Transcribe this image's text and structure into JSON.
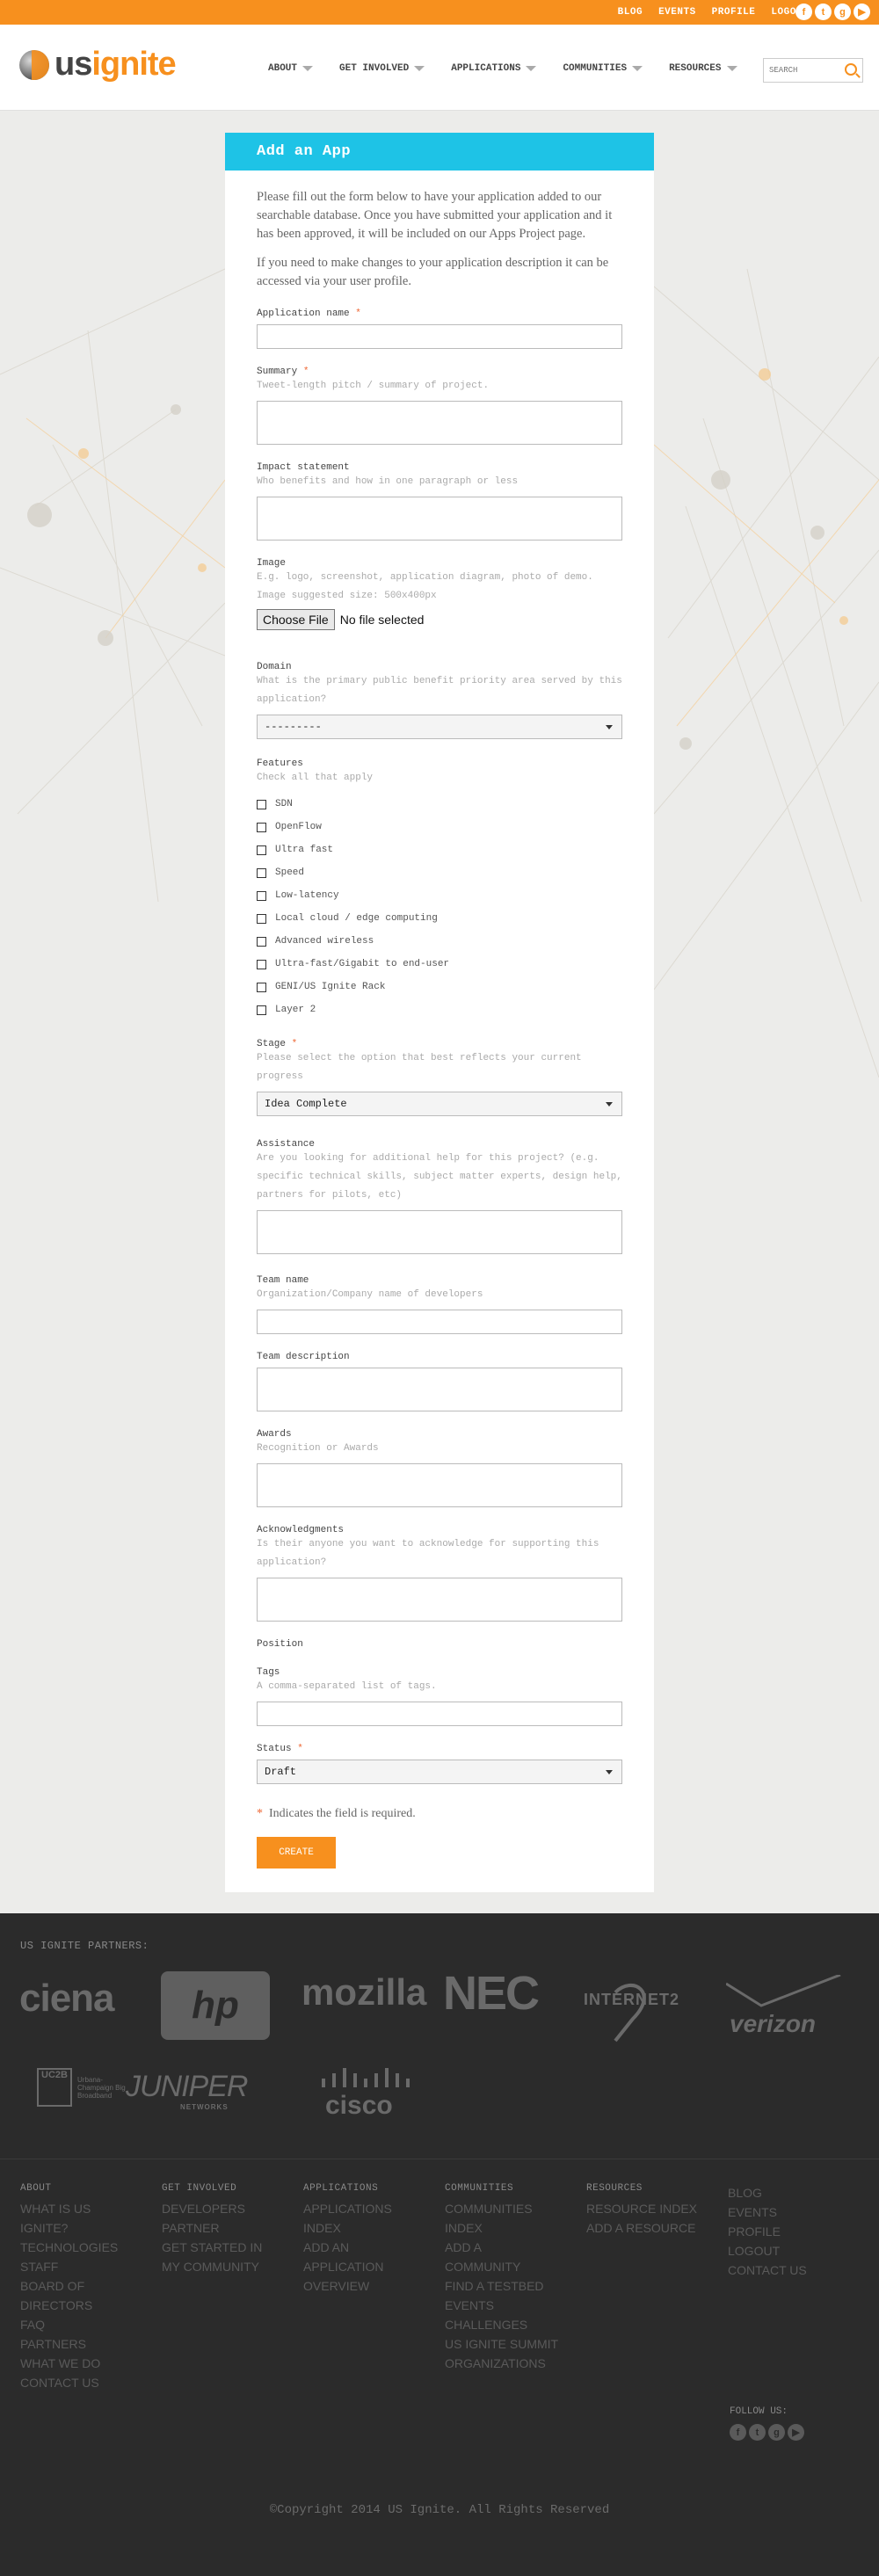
{
  "topbar": {
    "links": [
      "BLOG",
      "EVENTS",
      "PROFILE",
      "LOGOUT"
    ],
    "social": [
      {
        "icon": "facebook-icon",
        "glyph": "f"
      },
      {
        "icon": "twitter-icon",
        "glyph": "t"
      },
      {
        "icon": "google-plus-icon",
        "glyph": "g"
      },
      {
        "icon": "youtube-icon",
        "glyph": "▶"
      }
    ]
  },
  "header": {
    "logo_us": "us",
    "logo_ignite": "ignite",
    "nav": [
      "ABOUT",
      "GET INVOLVED",
      "APPLICATIONS",
      "COMMUNITIES",
      "RESOURCES"
    ],
    "search_placeholder": "SEARCH"
  },
  "form": {
    "title": "Add an App",
    "intro1": "Please fill out the form below to have your application added to our searchable database. Once you have submitted your application and it has been approved, it will be included on our Apps Project page.",
    "intro2": "If you need to make changes to your application description it can be accessed via your user profile.",
    "app_name": {
      "label": "Application name",
      "req": "*"
    },
    "summary": {
      "label": "Summary",
      "req": "*",
      "help": "Tweet-length pitch / summary of project."
    },
    "impact": {
      "label": "Impact statement",
      "help": "Who benefits and how in one paragraph or less"
    },
    "image": {
      "label": "Image",
      "help": "E.g. logo, screenshot, application diagram, photo of demo.",
      "help2": "Image suggested size: 500x400px",
      "button": "Choose File",
      "status": "No file selected"
    },
    "domain": {
      "label": "Domain",
      "help": "What is the primary public benefit priority area served by this application?",
      "value": "---------"
    },
    "features": {
      "label": "Features",
      "help": "Check all that apply",
      "options": [
        "SDN",
        "OpenFlow",
        "Ultra fast",
        "Speed",
        "Low-latency",
        "Local cloud / edge computing",
        "Advanced wireless",
        "Ultra-fast/Gigabit to end-user",
        "GENI/US Ignite Rack",
        "Layer 2"
      ]
    },
    "stage": {
      "label": "Stage",
      "req": "*",
      "help": "Please select the option that best reflects your current progress",
      "value": "Idea Complete"
    },
    "assistance": {
      "label": "Assistance",
      "help": "Are you looking for additional help for this project? (e.g. specific technical skills, subject matter experts, design help, partners for pilots, etc)"
    },
    "team_name": {
      "label": "Team name",
      "help": "Organization/Company name of developers"
    },
    "team_description": {
      "label": "Team description"
    },
    "awards": {
      "label": "Awards",
      "help": "Recognition or Awards"
    },
    "acknowledgments": {
      "label": "Acknowledgments",
      "help": "Is their anyone you want to acknowledge for supporting this application?"
    },
    "position": {
      "label": "Position"
    },
    "tags": {
      "label": "Tags",
      "help": "A comma-separated list of tags."
    },
    "status": {
      "label": "Status",
      "req": "*",
      "value": "Draft"
    },
    "required_note_star": "*",
    "required_note": "Indicates the field is required.",
    "create": "CREATE"
  },
  "partners": {
    "title": "US IGNITE PARTNERS:",
    "logos": [
      "ciena",
      "hp",
      "mozilla",
      "NEC",
      "INTERNET2",
      "verizon",
      "UC2B",
      "Urbana-Champaign Big Broadband",
      "JUNIPER",
      "NETWORKS",
      "cisco"
    ]
  },
  "footer": {
    "columns": [
      {
        "head": "ABOUT",
        "links": [
          "WHAT IS US",
          "IGNITE?",
          "TECHNOLOGIES",
          "STAFF",
          "BOARD OF",
          "DIRECTORS",
          "FAQ",
          "PARTNERS",
          "WHAT WE DO",
          "CONTACT US"
        ]
      },
      {
        "head": "GET INVOLVED",
        "links": [
          "DEVELOPERS",
          "PARTNER",
          "GET STARTED IN",
          "MY COMMUNITY"
        ]
      },
      {
        "head": "APPLICATIONS",
        "links": [
          "APPLICATIONS",
          "INDEX",
          "ADD AN",
          "APPLICATION",
          "OVERVIEW"
        ]
      },
      {
        "head": "COMMUNITIES",
        "links": [
          "COMMUNITIES",
          "INDEX",
          "ADD A",
          "COMMUNITY",
          "FIND A TESTBED",
          "EVENTS",
          "CHALLENGES",
          "US IGNITE SUMMIT",
          "ORGANIZATIONS"
        ]
      },
      {
        "head": "RESOURCES",
        "links": [
          "RESOURCE INDEX",
          "ADD A RESOURCE"
        ]
      },
      {
        "head": "",
        "links": [
          "BLOG",
          "EVENTS",
          "PROFILE",
          "LOGOUT",
          "CONTACT US"
        ]
      }
    ],
    "follow": "FOLLOW US:",
    "copyright": "©Copyright 2014 US Ignite. All Rights Reserved"
  },
  "colors": {
    "orange": "#f7901e",
    "cyan": "#1ec3e6",
    "dark": "#2b2b2b"
  }
}
